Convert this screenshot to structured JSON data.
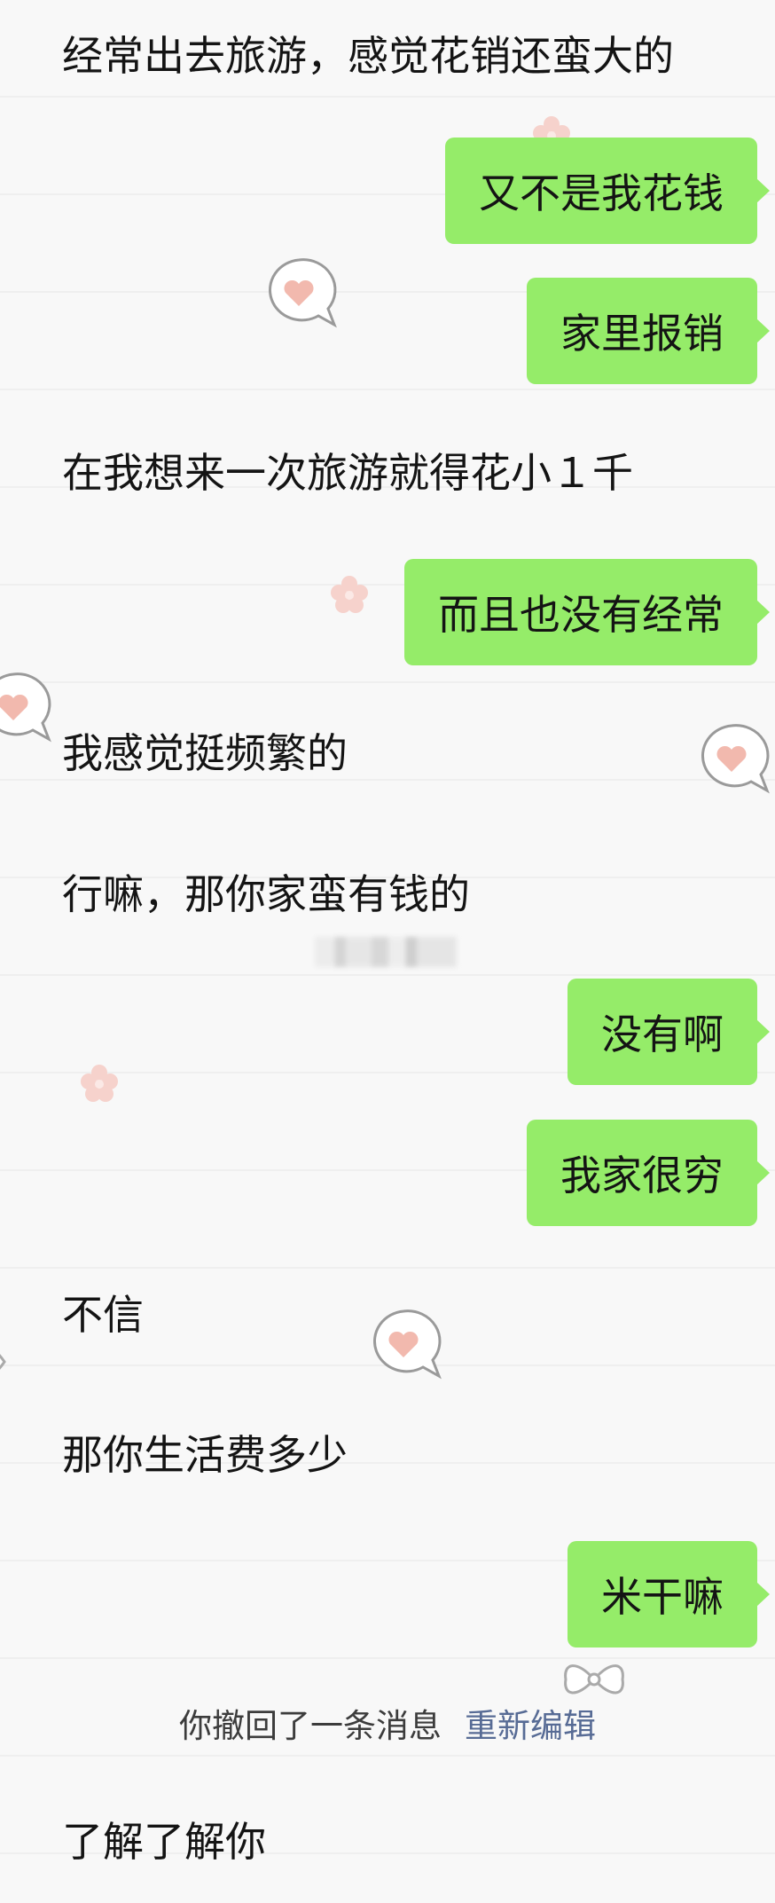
{
  "colors": {
    "outgoing_bubble": "#95ec69",
    "link": "#576b95",
    "background": "#f8f8f8"
  },
  "messages": [
    {
      "side": "left",
      "text": "经常出去旅游，感觉花销还蛮大的"
    },
    {
      "side": "right",
      "text": "又不是我花钱"
    },
    {
      "side": "right",
      "text": "家里报销"
    },
    {
      "side": "left",
      "text": "在我想来一次旅游就得花小１千"
    },
    {
      "side": "right",
      "text": "而且也没有经常"
    },
    {
      "side": "left",
      "text": "我感觉挺频繁的"
    },
    {
      "side": "left",
      "text": "行嘛，那你家蛮有钱的"
    },
    {
      "side": "right",
      "text": "没有啊"
    },
    {
      "side": "right",
      "text": "我家很穷"
    },
    {
      "side": "left",
      "text": "不信"
    },
    {
      "side": "left",
      "text": "那你生活费多少"
    },
    {
      "side": "right",
      "text": "米干嘛"
    },
    {
      "side": "left",
      "text": "了解了解你"
    }
  ],
  "system_notice": {
    "text": "你撤回了一条消息",
    "action": "重新编辑"
  },
  "decorations": [
    "heart-speech-bubble-icon",
    "flower-icon",
    "bow-icon"
  ]
}
